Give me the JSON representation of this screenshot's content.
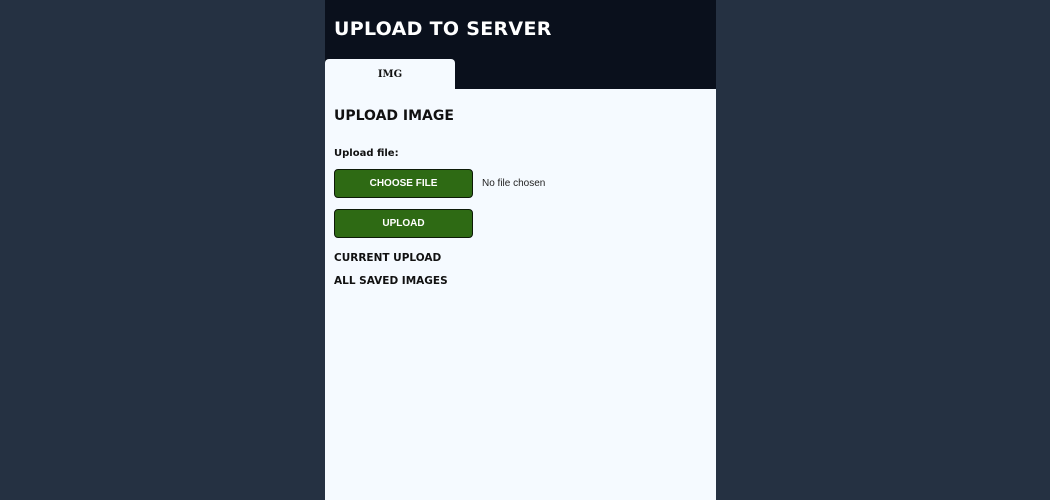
{
  "header": {
    "title": "UPLOAD TO SERVER"
  },
  "tabs": [
    {
      "label": "IMG",
      "active": true
    }
  ],
  "main": {
    "section_title": "UPLOAD IMAGE",
    "file_label": "Upload file:",
    "choose_file_label": "CHOOSE FILE",
    "file_status": "No file chosen",
    "upload_label": "UPLOAD",
    "current_upload_heading": "CURRENT UPLOAD",
    "saved_images_heading": "ALL SAVED IMAGES"
  },
  "colors": {
    "page_background": "#253142",
    "header_background": "#0a101c",
    "panel_background": "#f5faff",
    "button_green": "#2e6a14"
  }
}
